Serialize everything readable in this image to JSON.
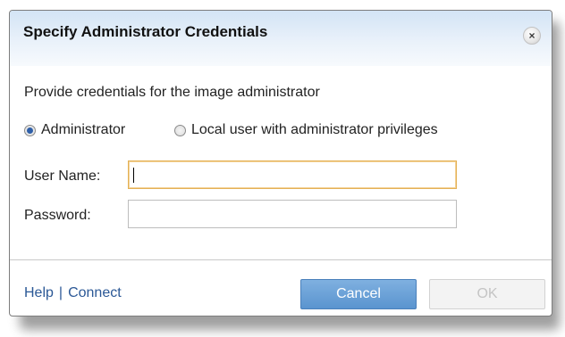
{
  "dialog": {
    "title": "Specify Administrator Credentials",
    "close_glyph": "×",
    "instruction": "Provide credentials for the image administrator",
    "radio_options": [
      {
        "label": "Administrator",
        "checked": true
      },
      {
        "label": "Local user with administrator privileges",
        "checked": false
      }
    ],
    "fields": {
      "username_label": "User Name:",
      "username_value": "",
      "password_label": "Password:",
      "password_value": ""
    },
    "footer": {
      "help_link": "Help",
      "separator": "|",
      "connect_link": "Connect",
      "cancel_label": "Cancel",
      "ok_label": "OK",
      "ok_enabled": false
    }
  },
  "colors": {
    "titlebar_top": "#d3e4f5",
    "link": "#2b5896",
    "primary_button": "#5a94cf",
    "focus_border": "#e4b155",
    "disabled_text": "#c4c4c4"
  },
  "icons": {
    "close": "close-icon",
    "radio_checked": "radio-checked-icon",
    "radio_unchecked": "radio-unchecked-icon"
  }
}
